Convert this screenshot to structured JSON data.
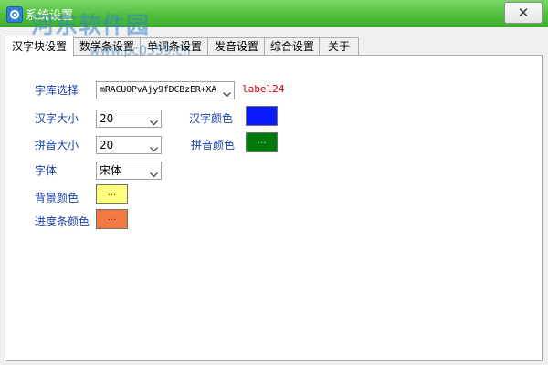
{
  "window": {
    "title": "系统设置",
    "close_label": "✕",
    "watermark": "河东软件园",
    "watermark_url": "www.pc0359.cn"
  },
  "tabs": [
    {
      "label": "汉字块设置",
      "active": true
    },
    {
      "label": "数学条设置",
      "active": false
    },
    {
      "label": "单词条设置",
      "active": false
    },
    {
      "label": "发音设置",
      "active": false
    },
    {
      "label": "综合设置",
      "active": false
    },
    {
      "label": "关于",
      "active": false
    }
  ],
  "form": {
    "font_library": {
      "label": "字库选择",
      "value": "mRACUOPvAjy9fDCBzER+XA"
    },
    "font_preview_label": "label24",
    "hanzi_size": {
      "label": "汉字大小",
      "value": "20"
    },
    "hanzi_color": {
      "label": "汉字颜色",
      "color": "#0a1cff",
      "dots": ""
    },
    "pinyin_size": {
      "label": "拼音大小",
      "value": "20"
    },
    "pinyin_color": {
      "label": "拼音颜色",
      "color": "#007a0c",
      "dots": "..."
    },
    "font": {
      "label": "字体",
      "value": "宋体"
    },
    "background_color": {
      "label": "背景颜色",
      "color": "#ffff80",
      "dots": "..."
    },
    "progress_color": {
      "label": "进度条颜色",
      "color": "#f57942",
      "dots": "..."
    }
  },
  "icons": {
    "app": "gear-icon",
    "close": "close-icon",
    "dropdown": "chevron-down-icon"
  }
}
